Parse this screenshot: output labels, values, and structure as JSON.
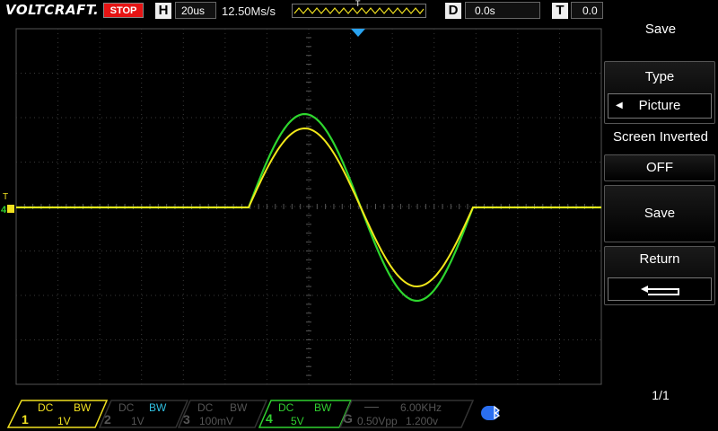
{
  "header": {
    "brand": "VOLTCRAFT.",
    "run_state": "STOP",
    "h_label": "H",
    "timebase": "20us",
    "sample_rate": "12.50Ms/s",
    "trigger_marker": "T",
    "d_label": "D",
    "delay": "0.0s",
    "t_label": "T",
    "trigger_level": "0.0"
  },
  "menu": {
    "title": "Save",
    "type_label": "Type",
    "type_value": "Picture",
    "screen_inverted_label": "Screen Inverted",
    "screen_inverted_value": "OFF",
    "save_label": "Save",
    "return_label": "Return",
    "page": "1/1"
  },
  "channels": [
    {
      "num": "1",
      "coupling": "DC",
      "bw": "BW",
      "scale": "1V",
      "color": "#f0e020",
      "active": true
    },
    {
      "num": "2",
      "coupling": "DC",
      "bw": "BW",
      "scale": "1V",
      "color": "#30c0e0",
      "active": false
    },
    {
      "num": "3",
      "coupling": "DC",
      "bw": "BW",
      "scale": "100mV",
      "color": "#b040c0",
      "active": false
    },
    {
      "num": "4",
      "coupling": "DC",
      "bw": "BW",
      "scale": "5V",
      "color": "#30d030",
      "active": true
    }
  ],
  "generator": {
    "label": "G",
    "frequency": "6.00KHz",
    "amplitude": "0.50Vpp",
    "offset": "1.200v"
  },
  "trace_colors": {
    "ch1": "#f2e81a",
    "ch4": "#2ed62e",
    "grid": "#3a3a3a",
    "trigger": "#29a3f0"
  },
  "icons": {
    "bluetooth": "bluetooth-icon",
    "return": "return-arrow-icon"
  }
}
